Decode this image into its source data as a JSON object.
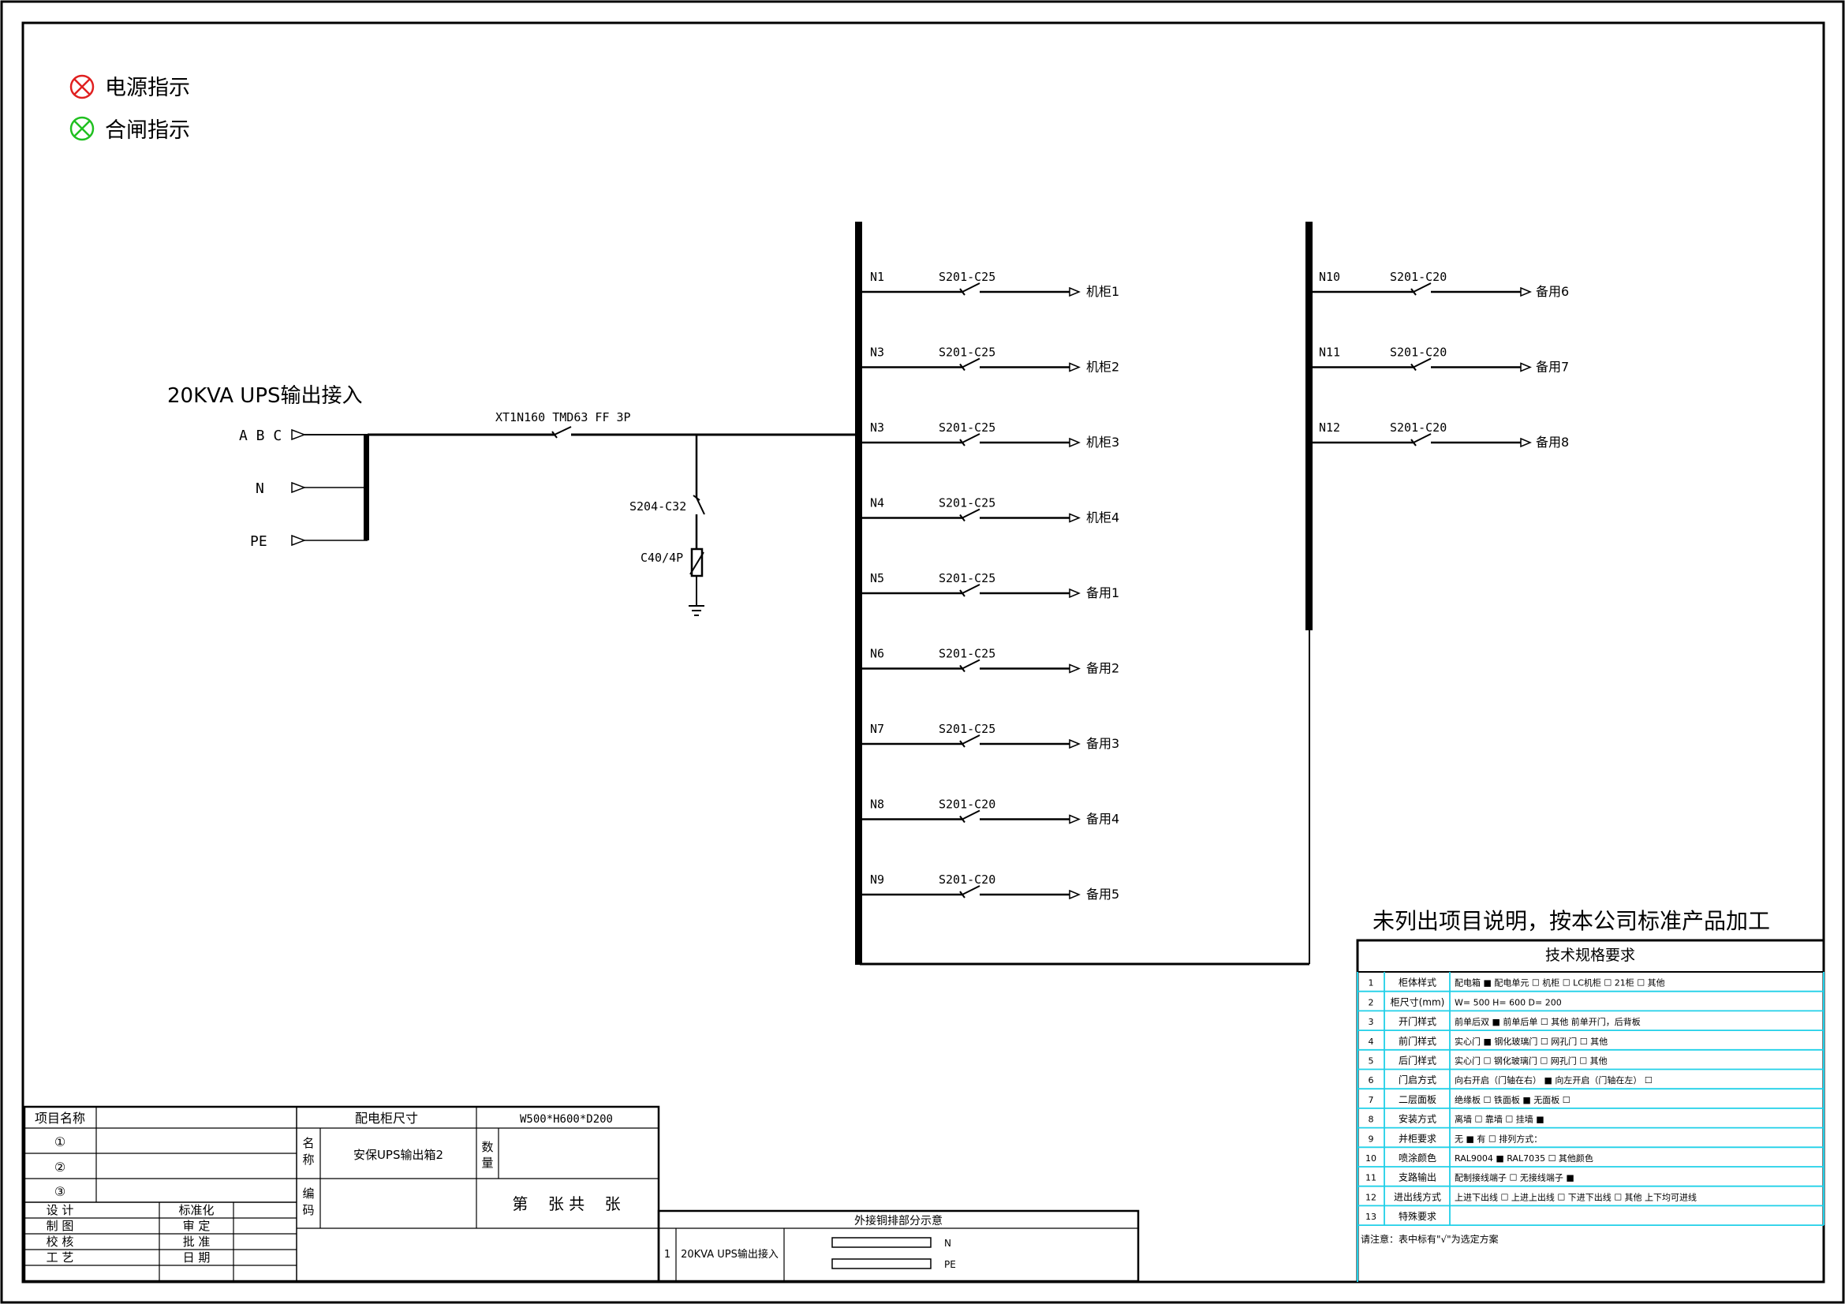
{
  "legend": {
    "power": {
      "label": "电源指示",
      "color": "#e02020"
    },
    "closing": {
      "label": "合闸指示",
      "color": "#20c020"
    }
  },
  "input": {
    "title": "20KVA UPS输出接入",
    "phases": [
      "A B C",
      "N",
      "PE"
    ],
    "main_breaker": "XT1N160 TMD63 FF 3P",
    "spd_breaker": "S204-C32",
    "spd": "C40/4P"
  },
  "circuits_left": [
    {
      "id": "N1",
      "breaker": "S201-C25",
      "load": "机柜1"
    },
    {
      "id": "N3",
      "breaker": "S201-C25",
      "load": "机柜2"
    },
    {
      "id": "N3",
      "breaker": "S201-C25",
      "load": "机柜3"
    },
    {
      "id": "N4",
      "breaker": "S201-C25",
      "load": "机柜4"
    },
    {
      "id": "N5",
      "breaker": "S201-C25",
      "load": "备用1"
    },
    {
      "id": "N6",
      "breaker": "S201-C25",
      "load": "备用2"
    },
    {
      "id": "N7",
      "breaker": "S201-C25",
      "load": "备用3"
    },
    {
      "id": "N8",
      "breaker": "S201-C20",
      "load": "备用4"
    },
    {
      "id": "N9",
      "breaker": "S201-C20",
      "load": "备用5"
    }
  ],
  "circuits_right": [
    {
      "id": "N10",
      "breaker": "S201-C20",
      "load": "备用6"
    },
    {
      "id": "N11",
      "breaker": "S201-C20",
      "load": "备用7"
    },
    {
      "id": "N12",
      "breaker": "S201-C20",
      "load": "备用8"
    }
  ],
  "spec": {
    "headline": "未列出项目说明，按本公司标准产品加工",
    "title": "技术规格要求",
    "rows": [
      {
        "no": "1",
        "label": "柜体样式",
        "content": "配电箱 ■  配电单元 ☐  机柜 ☐  LC机柜 ☐  21柜 ☐  其他"
      },
      {
        "no": "2",
        "label": "柜尺寸(mm)",
        "content": "W= 500   H= 600   D= 200"
      },
      {
        "no": "3",
        "label": "开门样式",
        "content": "前单后双 ■  前单后单 ☐  其他  前单开门，后背板"
      },
      {
        "no": "4",
        "label": "前门样式",
        "content": "实心门 ■  钢化玻璃门 ☐  网孔门 ☐  其他"
      },
      {
        "no": "5",
        "label": "后门样式",
        "content": "实心门 ☐  钢化玻璃门 ☐  网孔门 ☐  其他"
      },
      {
        "no": "6",
        "label": "门启方式",
        "content": "向右开启（门轴在右） ■  向左开启（门轴在左） ☐"
      },
      {
        "no": "7",
        "label": "二层面板",
        "content": "绝缘板 ☐  铁面板 ■  无面板 ☐"
      },
      {
        "no": "8",
        "label": "安装方式",
        "content": "离墙 ☐  靠墙 ☐  挂墙 ■"
      },
      {
        "no": "9",
        "label": "并柜要求",
        "content": "无 ■  有 ☐  排列方式："
      },
      {
        "no": "10",
        "label": "喷涂颜色",
        "content": "RAL9004 ■  RAL7035 ☐  其他颜色"
      },
      {
        "no": "11",
        "label": "支路输出",
        "content": "配制接线端子 ☐  无接线端子 ■"
      },
      {
        "no": "12",
        "label": "进出线方式",
        "content": "上进下出线 ☐  上进上出线 ☐  下进下出线 ☐  其他  上下均可进线"
      },
      {
        "no": "13",
        "label": "特殊要求",
        "content": ""
      }
    ],
    "note": "请注意：表中标有\"√\"为选定方案"
  },
  "title_block": {
    "project_name_label": "项目名称",
    "items": [
      "①",
      "②",
      "③"
    ],
    "cabinet_size_label": "配电柜尺寸",
    "cabinet_size_value": "W500*H600*D200",
    "name_label": "名称",
    "name_value": "安保UPS输出箱2",
    "qty_label": "数量",
    "code_label": "编码",
    "sheet_text": "第    张 共    张",
    "roles": [
      [
        "设  计",
        "标准化"
      ],
      [
        "制  图",
        "审  定"
      ],
      [
        "校  核",
        "批  准"
      ],
      [
        "工  艺",
        "日  期"
      ]
    ]
  },
  "busbar_table": {
    "title": "外接铜排部分示意",
    "row_no": "1",
    "row_label": "20KVA UPS输出接入",
    "labels": [
      "N",
      "PE"
    ]
  }
}
